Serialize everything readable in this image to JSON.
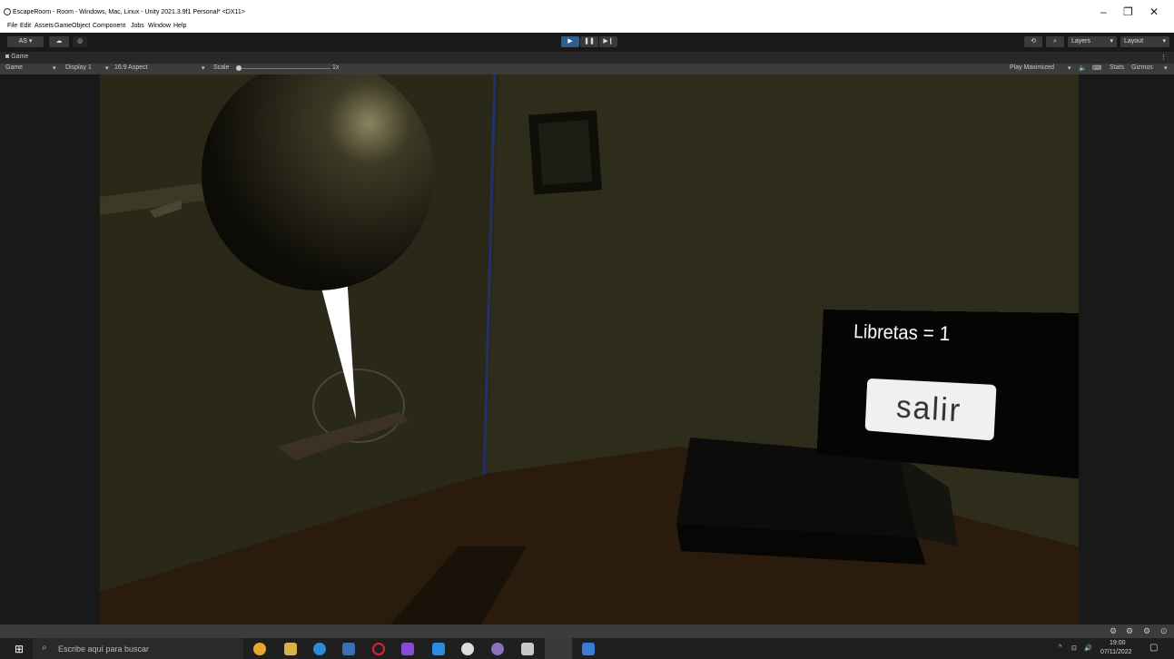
{
  "window": {
    "title": "EscapeRoom - Room - Windows, Mac, Linux - Unity 2021.3.9f1 Personal* <DX11>",
    "minimize": "–",
    "maximize": "❐",
    "close": "✕"
  },
  "menu": [
    "File",
    "Edit",
    "Assets",
    "GameObject",
    "Component",
    "Jobs",
    "Window",
    "Help"
  ],
  "toolbar": {
    "account": "AS ▾",
    "layers": "Layers",
    "layout": "Layout"
  },
  "panel_tab": "Game",
  "game_options": {
    "mode": "Game",
    "display": "Display 1",
    "aspect": "16:9 Aspect",
    "scale_label": "Scale",
    "scale_value": "1x",
    "play_mode": "Play Maximized",
    "stats": "Stats",
    "gizmos": "Gizmos"
  },
  "scene": {
    "counter_text": "Libretas = 1",
    "exit_button": "salir"
  },
  "taskbar": {
    "search_placeholder": "Escribe aquí para buscar",
    "time": "19:00",
    "date": "07/11/2022"
  },
  "colors": {
    "play_active": "#2f5d8c",
    "editor_bg": "#191919"
  }
}
